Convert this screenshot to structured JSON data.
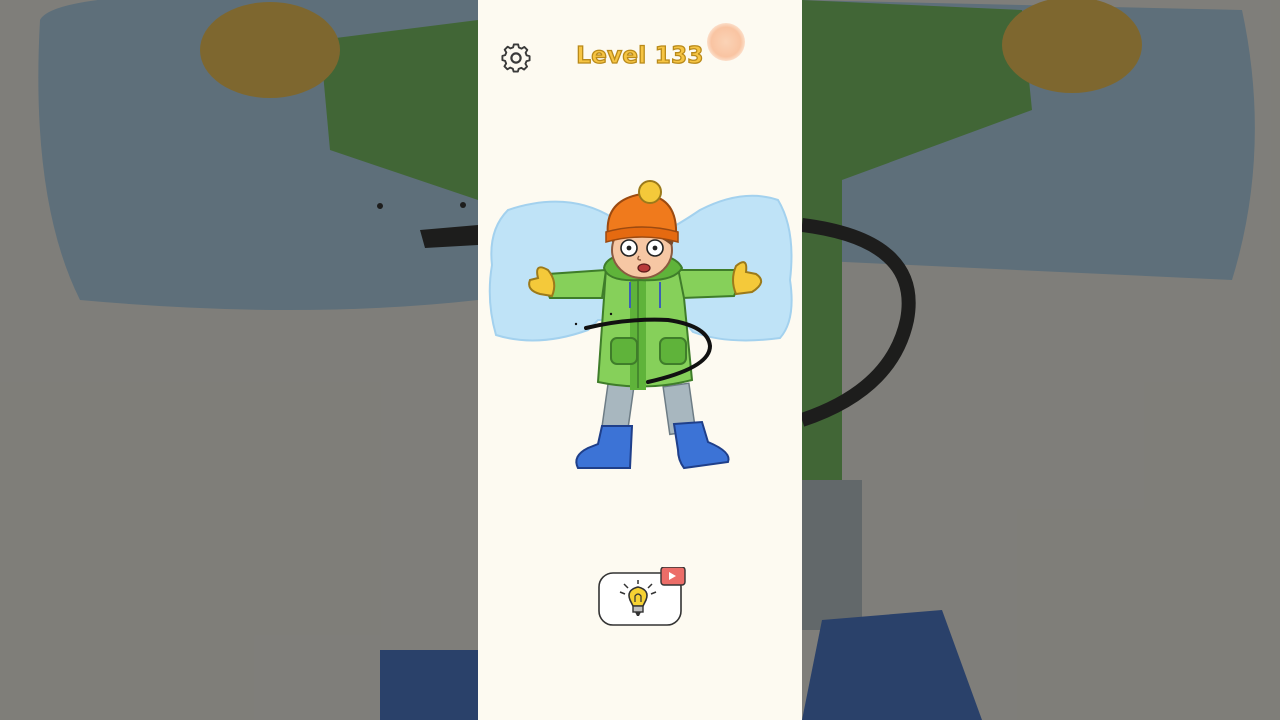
{
  "game": {
    "level_label": "Level 133",
    "settings_icon": "gear-icon",
    "hint_icon": "lightbulb-icon",
    "ad_badge_icon": "video-play-icon"
  },
  "colors": {
    "panel_background": "#fdfaf1",
    "level_text": "#f6c443",
    "level_outline": "#b98a1a",
    "snow_angel": "#bfe3f7",
    "coat": "#86d05a",
    "hat": "#f07a1c",
    "boots": "#3c73d6",
    "drawn_line": "#111111",
    "ad_badge": "#ec6d68"
  }
}
